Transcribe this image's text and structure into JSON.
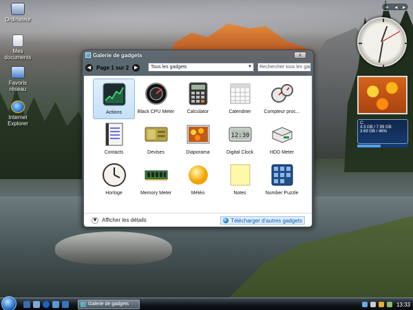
{
  "desktop": {
    "icons": [
      {
        "label": "Ordinateur"
      },
      {
        "label": "Mes documents"
      },
      {
        "label": "Favoris réseau"
      },
      {
        "label": "Internet Explorer"
      }
    ]
  },
  "window": {
    "title": "Galerie de gadgets",
    "close_label": "x",
    "page_label": "Page 1 sur 2",
    "nav_prev": "◀",
    "nav_next": "▶",
    "filter_value": "Tous les gadgets",
    "search_placeholder": "Rechercher tous les gadgets",
    "gadgets": [
      {
        "label": "Actions",
        "icon": "stocks-icon"
      },
      {
        "label": "Black CPU Meter",
        "icon": "cpu-meter-icon"
      },
      {
        "label": "Calculator",
        "icon": "calculator-icon"
      },
      {
        "label": "Calendrier",
        "icon": "calendar-icon"
      },
      {
        "label": "Compteur proc...",
        "icon": "cpu-gauge-icon"
      },
      {
        "label": "Contacts",
        "icon": "contacts-icon"
      },
      {
        "label": "Devises",
        "icon": "currency-icon"
      },
      {
        "label": "Diaporama",
        "icon": "slideshow-icon"
      },
      {
        "label": "Digital Clock",
        "icon": "digital-clock-icon"
      },
      {
        "label": "HDD Meter",
        "icon": "hdd-icon"
      },
      {
        "label": "Horloge",
        "icon": "clock-icon"
      },
      {
        "label": "Memory Meter",
        "icon": "memory-icon"
      },
      {
        "label": "Météo",
        "icon": "weather-icon"
      },
      {
        "label": "Notes",
        "icon": "notes-icon"
      },
      {
        "label": "Number Puzzle",
        "icon": "puzzle-icon"
      }
    ],
    "selected_gadget": "Actions",
    "digital_clock_text": "12:30",
    "details_label": "Afficher les détails",
    "download_label": "Télécharger d'autres gadgets"
  },
  "sidebar": {
    "controls": [
      "+",
      "◂",
      "▸"
    ],
    "cpu": {
      "drive": "C:",
      "line1": "4.3 GB / 7.99 GB",
      "line2": "3.69 GB / 46%",
      "usage_fraction": 0.46
    }
  },
  "taskbar": {
    "task_label": "Galerie de gadgets",
    "time": "13:33"
  }
}
